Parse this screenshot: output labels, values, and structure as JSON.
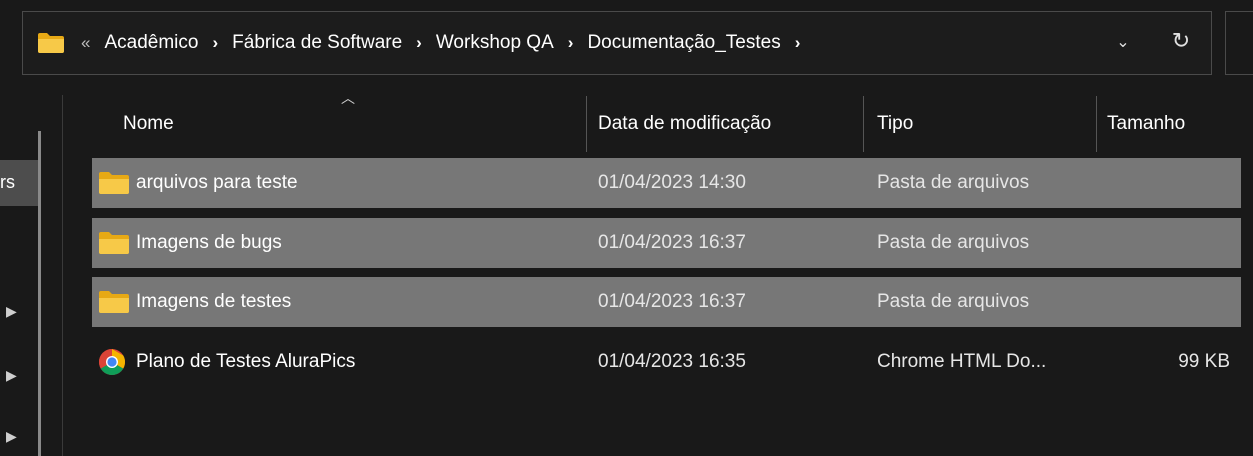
{
  "address_bar": {
    "overflow_symbol": "«",
    "breadcrumbs": [
      "Acadêmico",
      "Fábrica de Software",
      "Workshop QA",
      "Documentação_Testes"
    ],
    "separator": "›",
    "dropdown_symbol": "⌄",
    "refresh_symbol": "↻"
  },
  "nav_pane": {
    "partial_text": "rs"
  },
  "columns": {
    "name": "Nome",
    "date": "Data de modificação",
    "type": "Tipo",
    "size": "Tamanho"
  },
  "files": [
    {
      "name": "arquivos para teste",
      "date": "01/04/2023 14:30",
      "type": "Pasta de arquivos",
      "size": "",
      "icon": "folder-icon",
      "selected": true
    },
    {
      "name": "Imagens de bugs",
      "date": "01/04/2023 16:37",
      "type": "Pasta de arquivos",
      "size": "",
      "icon": "folder-icon",
      "selected": true
    },
    {
      "name": "Imagens de testes",
      "date": "01/04/2023 16:37",
      "type": "Pasta de arquivos",
      "size": "",
      "icon": "folder-icon",
      "selected": true
    },
    {
      "name": "Plano de Testes AluraPics",
      "date": "01/04/2023 16:35",
      "type": "Chrome HTML Do...",
      "size": "99 KB",
      "icon": "chrome-icon",
      "selected": false
    }
  ],
  "colors": {
    "background": "#191919",
    "selected_row": "#777777",
    "folder_yellow": "#f7c948"
  }
}
